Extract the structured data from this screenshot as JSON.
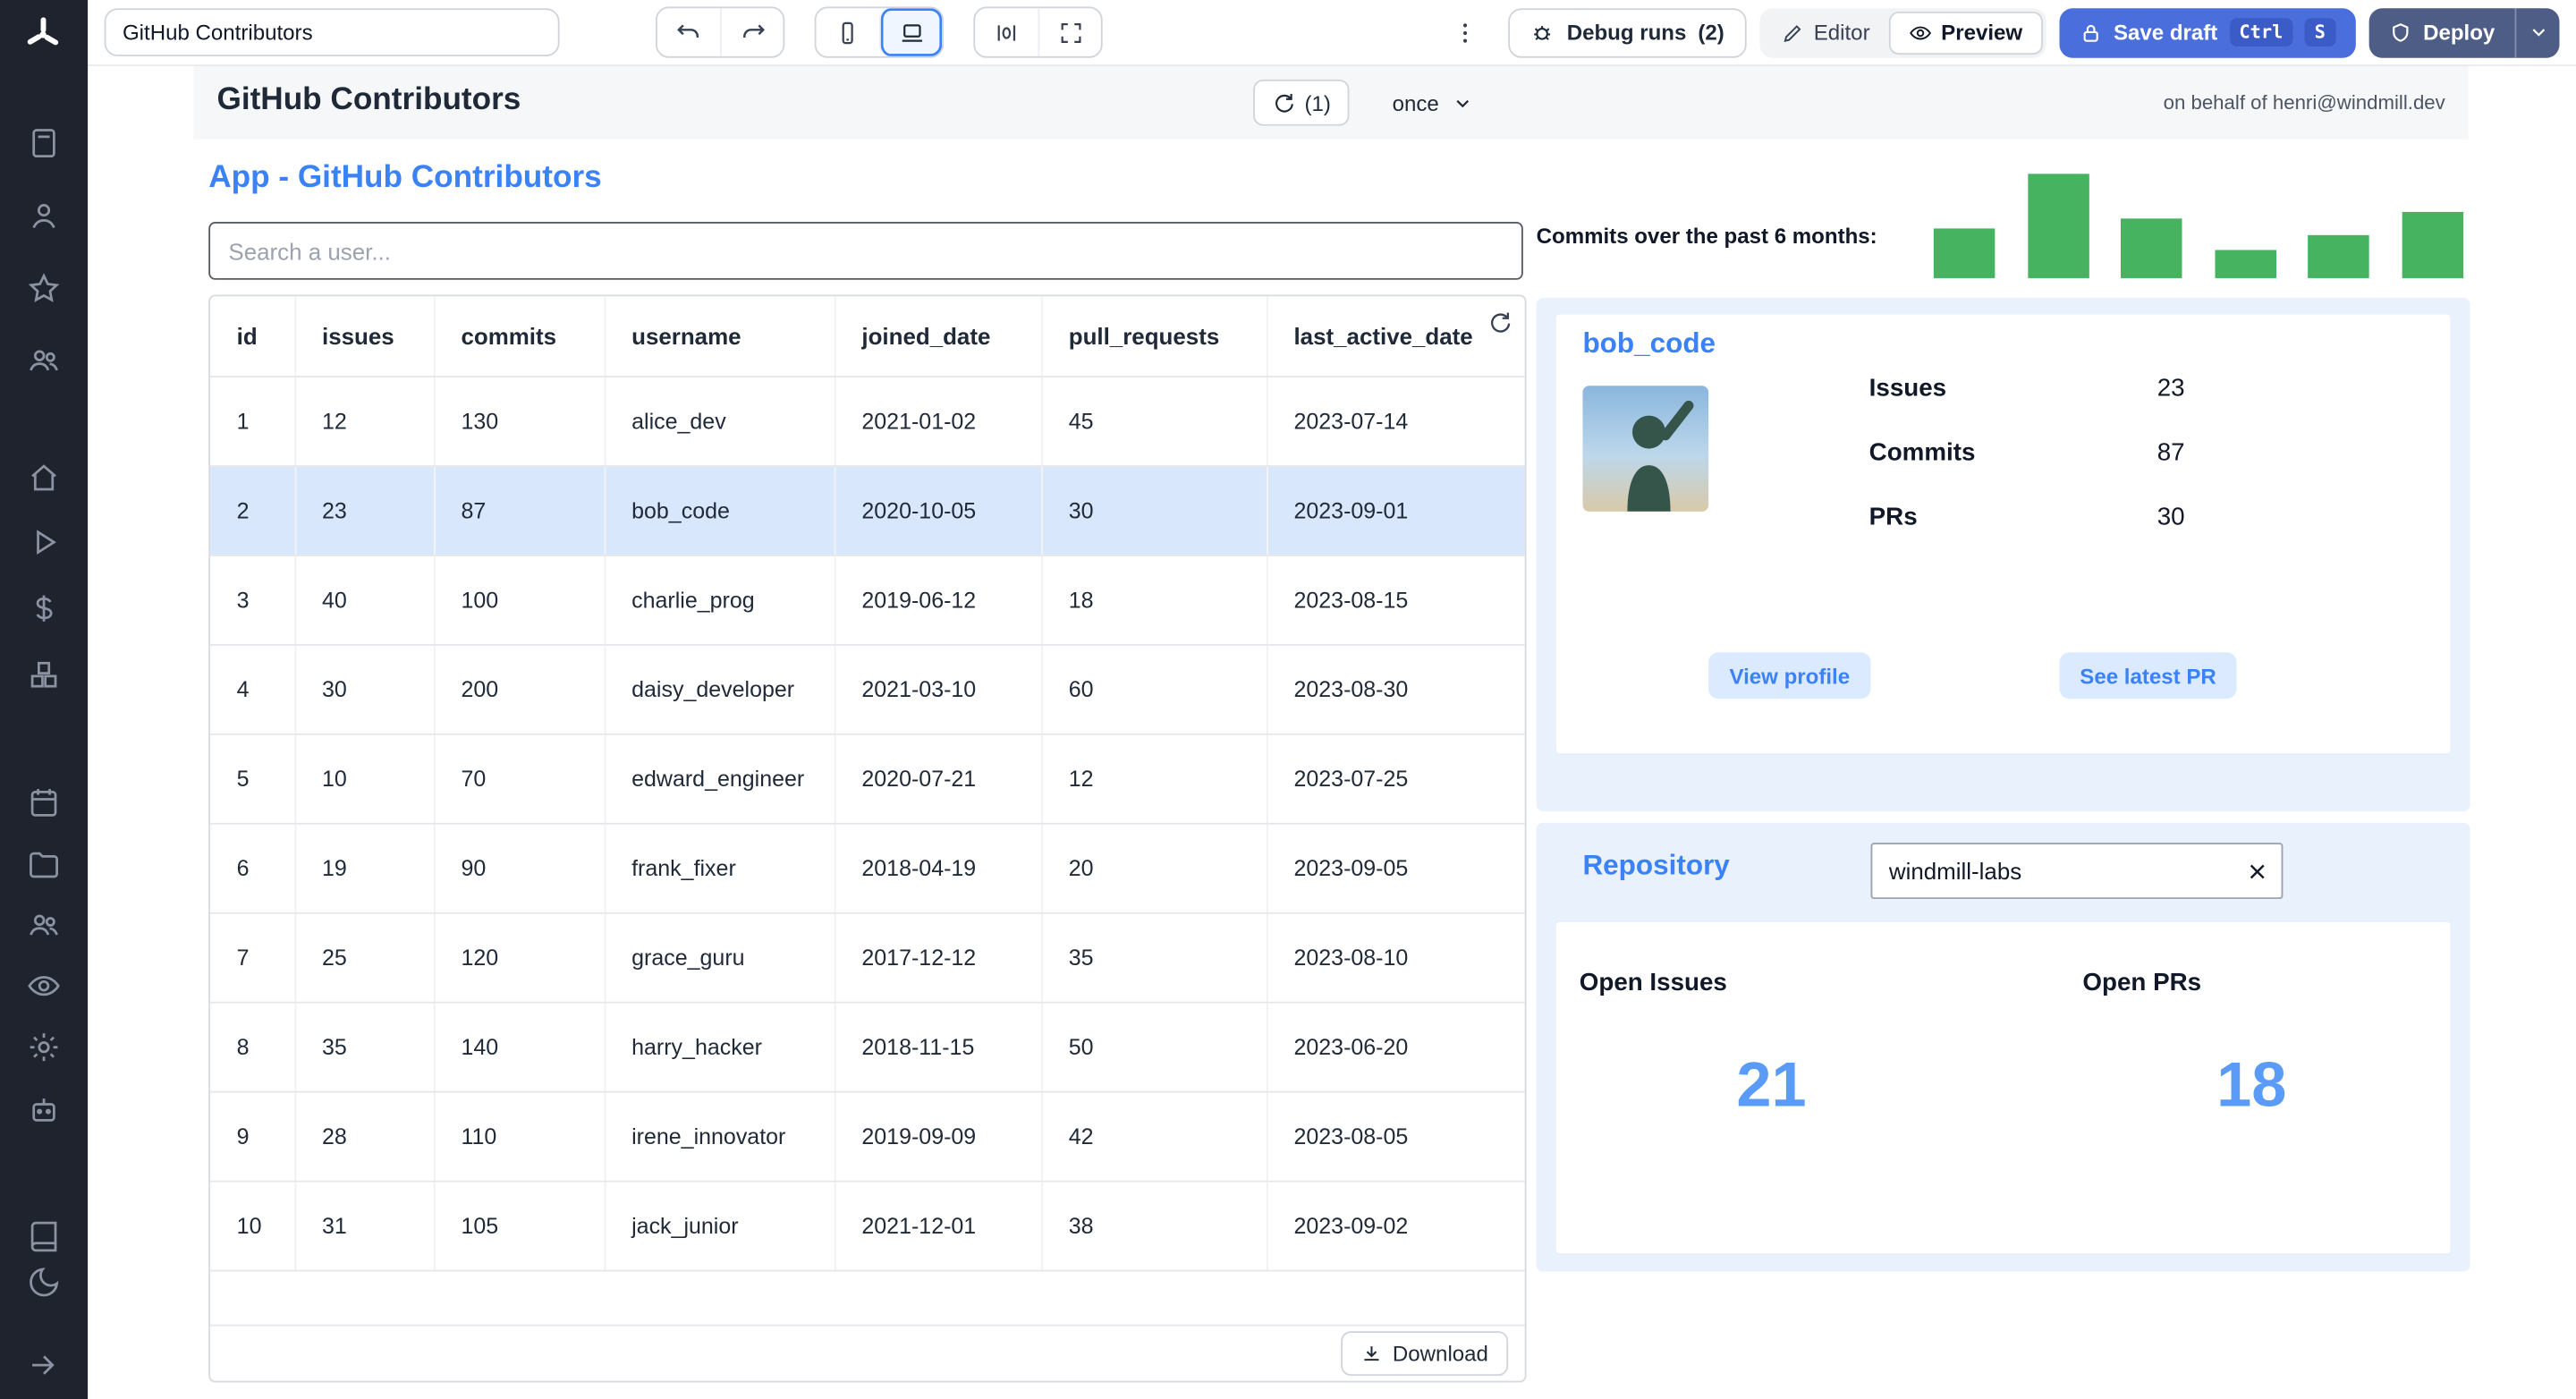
{
  "topbar": {
    "app_title": "GitHub Contributors",
    "debug_runs": "Debug runs",
    "debug_runs_count": "(2)",
    "editor": "Editor",
    "preview": "Preview",
    "save_draft": "Save draft",
    "kbd": [
      "Ctrl",
      "S"
    ],
    "deploy": "Deploy"
  },
  "app_header": {
    "title": "GitHub Contributors",
    "refresh_count": "(1)",
    "schedule": "once",
    "on_behalf": "on behalf of henri@windmill.dev"
  },
  "content": {
    "heading": "App - GitHub Contributors",
    "search_placeholder": "Search a user...",
    "download": "Download"
  },
  "table": {
    "columns": [
      "id",
      "issues",
      "commits",
      "username",
      "joined_date",
      "pull_requests",
      "last_active_date"
    ],
    "rows": [
      [
        "1",
        "12",
        "130",
        "alice_dev",
        "2021-01-02",
        "45",
        "2023-07-14"
      ],
      [
        "2",
        "23",
        "87",
        "bob_code",
        "2020-10-05",
        "30",
        "2023-09-01"
      ],
      [
        "3",
        "40",
        "100",
        "charlie_prog",
        "2019-06-12",
        "18",
        "2023-08-15"
      ],
      [
        "4",
        "30",
        "200",
        "daisy_developer",
        "2021-03-10",
        "60",
        "2023-08-30"
      ],
      [
        "5",
        "10",
        "70",
        "edward_engineer",
        "2020-07-21",
        "12",
        "2023-07-25"
      ],
      [
        "6",
        "19",
        "90",
        "frank_fixer",
        "2018-04-19",
        "20",
        "2023-09-05"
      ],
      [
        "7",
        "25",
        "120",
        "grace_guru",
        "2017-12-12",
        "35",
        "2023-08-10"
      ],
      [
        "8",
        "35",
        "140",
        "harry_hacker",
        "2018-11-15",
        "50",
        "2023-06-20"
      ],
      [
        "9",
        "28",
        "110",
        "irene_innovator",
        "2019-09-09",
        "42",
        "2023-08-05"
      ],
      [
        "10",
        "31",
        "105",
        "jack_junior",
        "2021-12-01",
        "38",
        "2023-09-02"
      ]
    ],
    "selected_row_index": 1,
    "selected_username": "bob_code"
  },
  "chart_data": {
    "type": "bar",
    "title": "Commits over the past 6 months:",
    "values": [
      48,
      100,
      57,
      27,
      41,
      63
    ],
    "unit": "relative-height",
    "color": "#45b360",
    "axes": "none"
  },
  "user_card": {
    "username": "bob_code",
    "stats": [
      {
        "label": "Issues",
        "value": "23"
      },
      {
        "label": "Commits",
        "value": "87"
      },
      {
        "label": "PRs",
        "value": "30"
      }
    ],
    "view_profile": "View profile",
    "see_latest_pr": "See latest PR"
  },
  "repository": {
    "heading": "Repository",
    "input_value": "windmill-labs",
    "open_issues_label": "Open Issues",
    "open_issues_value": "21",
    "open_prs_label": "Open PRs",
    "open_prs_value": "18"
  },
  "colors": {
    "accent_blue": "#3b82f6",
    "bar_green": "#45b360",
    "selected_row": "#d8e7fb",
    "panel_blue": "#e8f1fc",
    "save_button": "#4a6fdc",
    "deploy_button": "#4e5d86",
    "sidebar": "#1e232e"
  },
  "sidebar_icons": [
    "windmill-logo",
    "calculator",
    "user",
    "star",
    "users",
    "home",
    "play",
    "dollar",
    "boxes",
    "calendar",
    "folder",
    "group",
    "eye",
    "gear",
    "bot",
    "book",
    "moon",
    "collapse-arrow"
  ]
}
